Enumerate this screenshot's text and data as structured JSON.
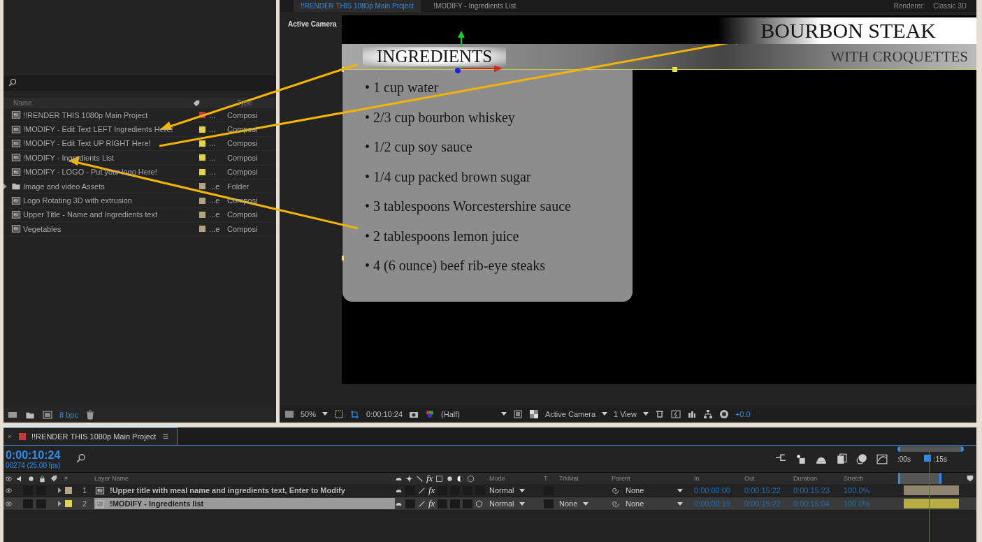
{
  "viewer_tabs": [
    {
      "label": "!!RENDER THIS 1080p Main Project",
      "selected": true
    },
    {
      "label": "!MODIFY - Ingredients List",
      "selected": false
    }
  ],
  "renderer": {
    "label": "Renderer:",
    "value": "Classic 3D"
  },
  "project": {
    "columns": [
      "Name",
      "Type"
    ],
    "items": [
      {
        "kind": "comp",
        "name": "!!RENDER THIS 1080p Main Project",
        "color": "#c33a3a",
        "label_text": "...",
        "type": "Composi"
      },
      {
        "kind": "comp",
        "name": "!MODIFY - Edit Text LEFT Ingredients Here!",
        "color": "#e2d54c",
        "label_text": "...",
        "type": "Composi"
      },
      {
        "kind": "comp",
        "name": "!MODIFY - Edit Text UP RIGHT Here!",
        "color": "#e2d54c",
        "label_text": "...",
        "type": "Composi"
      },
      {
        "kind": "comp",
        "name": "!MODIFY - Ingredients List",
        "color": "#e2d54c",
        "label_text": "...",
        "type": "Composi"
      },
      {
        "kind": "comp",
        "name": "!MODIFY - LOGO - Put your logo Here!",
        "color": "#e2d54c",
        "label_text": "...",
        "type": "Composi"
      },
      {
        "kind": "folder",
        "name": "Image and video Assets",
        "color": "#b3a385",
        "label_text": "...e",
        "type": "Folder"
      },
      {
        "kind": "comp",
        "name": "Logo Rotating 3D with extrusion",
        "color": "#b3a385",
        "label_text": "...e",
        "type": "Composi"
      },
      {
        "kind": "comp",
        "name": "Upper Title - Name and Ingredients text",
        "color": "#b3a385",
        "label_text": "...e",
        "type": "Composi"
      },
      {
        "kind": "comp",
        "name": "Vegetables",
        "color": "#b3a385",
        "label_text": "...e",
        "type": "Composi"
      }
    ],
    "bpc": "8 bpc"
  },
  "viewer": {
    "camera_label": "Active Camera",
    "title": "BOURBON STEAK",
    "subtitle": "WITH CROQUETTES",
    "heading": "INGREDIENTS",
    "ingredients": [
      "1 cup water",
      "2/3 cup bourbon whiskey",
      "1/2 cup soy sauce",
      "1/4 cup packed brown sugar",
      "3 tablespoons Worcestershire sauce",
      "2 tablespoons lemon juice",
      "4 (6 ounce) beef rib-eye steaks"
    ],
    "bullet": "•",
    "toolbar": {
      "zoom": "50%",
      "timecode": "0:00:10:24",
      "resolution": "(Half)",
      "camera": "Active Camera",
      "views": "1 View",
      "exposure": "+0.0"
    }
  },
  "timeline": {
    "tab": "!!RENDER THIS 1080p Main Project",
    "timecode": "0:00:10:24",
    "frame": "00274 (25.00 fps)",
    "columns": {
      "number": "#",
      "name": "Layer Name",
      "mode": "Mode",
      "t": "T",
      "trkmat": "TrkMat",
      "parent": "Parent",
      "in": "In",
      "out": "Out",
      "duration": "Duration",
      "stretch": "Stretch"
    },
    "fx_header": "fx",
    "ruler": [
      ":00s",
      ":15s"
    ],
    "layers": [
      {
        "number": "1",
        "name": "!Upper title with meal name and ingredients text, Enter to Modify",
        "color": "#b5a68a",
        "selected": false,
        "fx": "fx",
        "mode": "Normal",
        "parent": "None",
        "in": "0:00:00:00",
        "out": "0:00:15:22",
        "duration": "0:00:15:23",
        "stretch": "100.0%",
        "three_d": false
      },
      {
        "number": "2",
        "name": "!MODIFY - Ingredients list",
        "color": "#e0d44a",
        "selected": true,
        "fx": "fx",
        "mode": "Normal",
        "trkmat": "None",
        "parent": "None",
        "in": "0:00:00:19",
        "out": "0:00:15:22",
        "duration": "0:00:15:04",
        "stretch": "100.0%",
        "three_d": true
      }
    ]
  }
}
